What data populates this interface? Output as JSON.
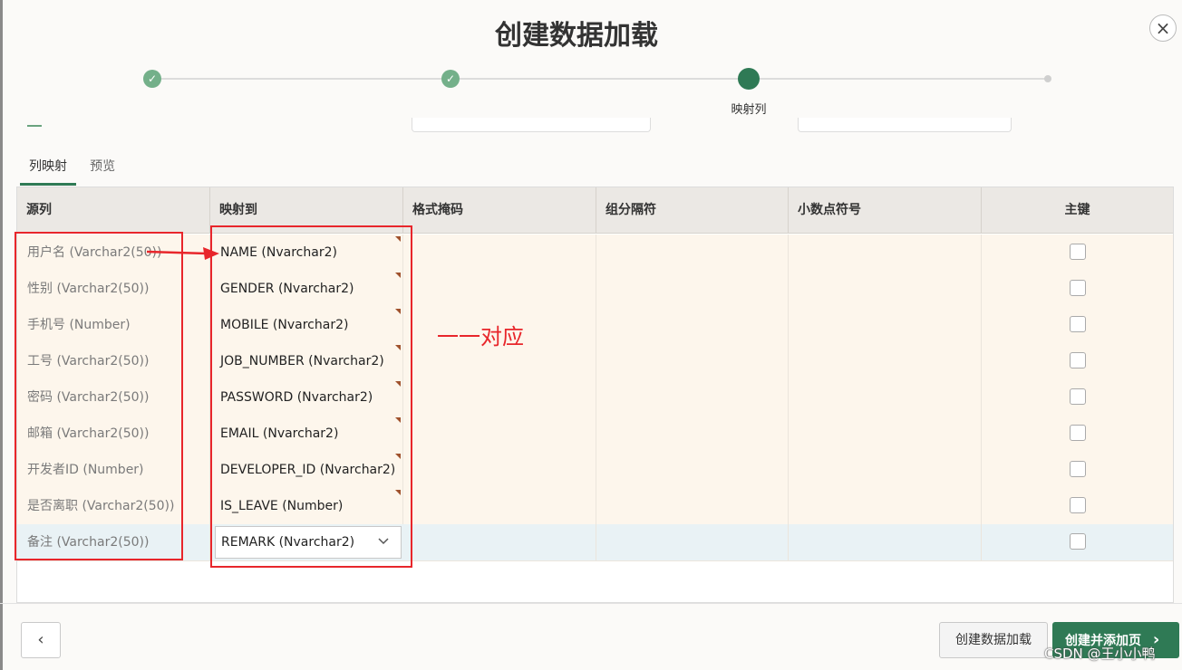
{
  "dialog": {
    "title": "创建数据加载",
    "close_icon": "×",
    "steps": [
      {
        "state": "complete",
        "icon": "check-icon",
        "glyph": "✓"
      },
      {
        "state": "complete",
        "icon": "check-icon",
        "glyph": "✓"
      },
      {
        "state": "current",
        "label": "映射列"
      },
      {
        "state": "future"
      }
    ]
  },
  "tabs": [
    {
      "label": "列映射",
      "active": true
    },
    {
      "label": "预览",
      "active": false
    }
  ],
  "grid": {
    "columns": [
      "源列",
      "映射到",
      "格式掩码",
      "组分隔符",
      "小数点符号",
      "主键"
    ],
    "rows": [
      {
        "source": "用户名 (Varchar2(50))",
        "target": "NAME (Nvarchar2)",
        "primary_key": false
      },
      {
        "source": "性别 (Varchar2(50))",
        "target": "GENDER (Nvarchar2)",
        "primary_key": false
      },
      {
        "source": "手机号 (Number)",
        "target": "MOBILE (Nvarchar2)",
        "primary_key": false
      },
      {
        "source": "工号 (Varchar2(50))",
        "target": "JOB_NUMBER (Nvarchar2)",
        "primary_key": false
      },
      {
        "source": "密码 (Varchar2(50))",
        "target": "PASSWORD (Nvarchar2)",
        "primary_key": false
      },
      {
        "source": "邮箱 (Varchar2(50))",
        "target": "EMAIL (Nvarchar2)",
        "primary_key": false
      },
      {
        "source": "开发者ID (Number)",
        "target": "DEVELOPER_ID (Nvarchar2)",
        "primary_key": false
      },
      {
        "source": "是否离职 (Varchar2(50))",
        "target": "IS_LEAVE (Number)",
        "primary_key": false
      },
      {
        "source": "备注 (Varchar2(50))",
        "target": "REMARK (Nvarchar2)",
        "primary_key": false,
        "selected": true
      }
    ]
  },
  "annotation": {
    "text": "一一对应",
    "color": "#e8262b"
  },
  "footer": {
    "back_icon": "‹",
    "create_label": "创建数据加载",
    "next_label": "创建并添加页",
    "next_icon": "›"
  },
  "watermark": "CSDN @王小小鸭",
  "colors": {
    "accent": "#2f7a55",
    "complete": "#74b08a",
    "annotation": "#e8262b",
    "row_bg": "#fdf6ec",
    "selected_row_bg": "#e9f2f5"
  }
}
